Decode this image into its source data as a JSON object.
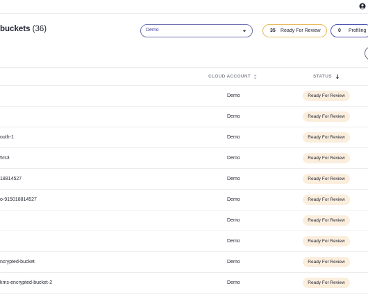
{
  "header": {
    "title": "buckets",
    "count": "(36)",
    "filter": {
      "value": "Demo"
    },
    "pills": [
      {
        "count": "35",
        "label": "Ready For Review"
      },
      {
        "count": "0",
        "label": "Profiling"
      }
    ]
  },
  "table": {
    "columns": {
      "cloud_account": "CLOUD ACCOUNT",
      "status": "STATUS"
    },
    "rows": [
      {
        "name": "",
        "cloud_account": "Demo",
        "status": "Ready For Review"
      },
      {
        "name": "",
        "cloud_account": "Demo",
        "status": "Ready For Review"
      },
      {
        "name": "outh-1",
        "cloud_account": "Demo",
        "status": "Ready For Review"
      },
      {
        "name": "5rs3",
        "cloud_account": "Demo",
        "status": "Ready For Review"
      },
      {
        "name": "18814527",
        "cloud_account": "Demo",
        "status": "Ready For Review"
      },
      {
        "name": "o-915018814527",
        "cloud_account": "Demo",
        "status": "Ready For Review"
      },
      {
        "name": "",
        "cloud_account": "Demo",
        "status": "Ready For Review"
      },
      {
        "name": "",
        "cloud_account": "Demo",
        "status": "Ready For Review"
      },
      {
        "name": "ncrypted-bucket",
        "cloud_account": "Demo",
        "status": "Ready For Review"
      },
      {
        "name": "kms-encrypted-bucket-2",
        "cloud_account": "Demo",
        "status": "Ready For Review"
      }
    ]
  },
  "icons": {
    "user": "user-circle-icon",
    "dropdown": "chevron-down-icon",
    "sort_cloud": "sort-updown-icon",
    "sort_status": "sort-down-arrow-icon"
  },
  "colors": {
    "accent": "#4b3fa0",
    "ready_border": "#e7b95a",
    "ready_badge_bg": "#fbeedd"
  }
}
